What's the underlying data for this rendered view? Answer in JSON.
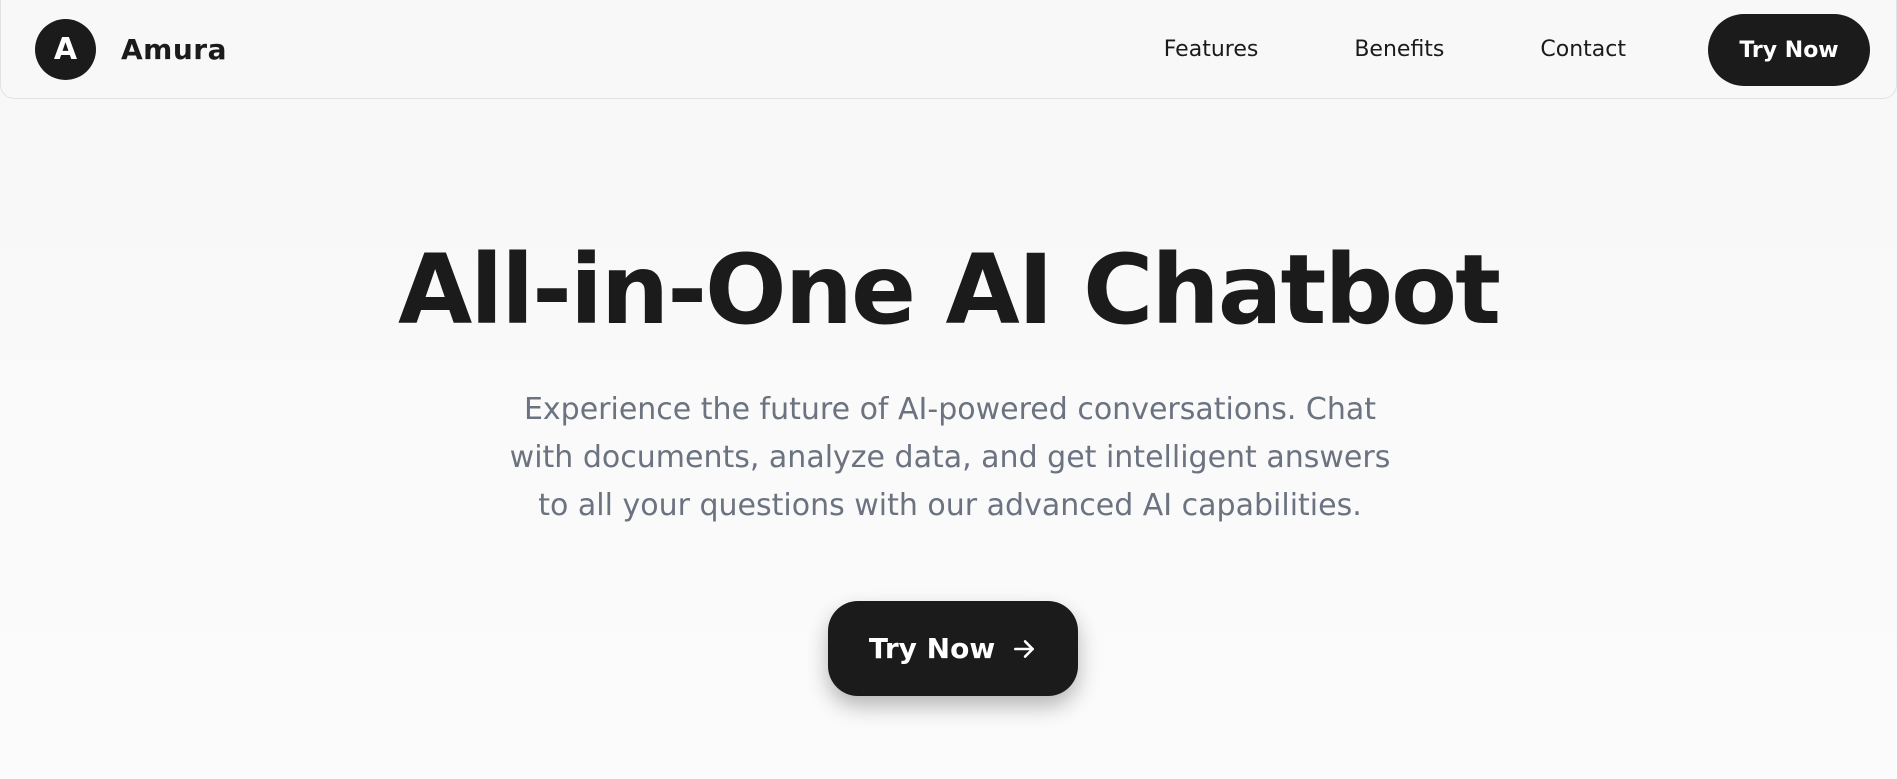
{
  "brand": {
    "logo_letter": "A",
    "name": "Amura"
  },
  "nav": {
    "links": [
      {
        "label": "Features"
      },
      {
        "label": "Benefits"
      },
      {
        "label": "Contact"
      }
    ],
    "cta_label": "Try Now"
  },
  "hero": {
    "title": "All-in-One AI Chatbot",
    "subtitle": "Experience the future of AI-powered conversations. Chat with documents, analyze data, and get intelligent answers to all your questions with our advanced AI capabilities.",
    "cta_label": "Try Now",
    "cta_icon": "arrow-right-icon"
  },
  "colors": {
    "primary": "#1b1b1b",
    "background": "#f8f8f8",
    "subtitle_text": "#6b7280"
  }
}
